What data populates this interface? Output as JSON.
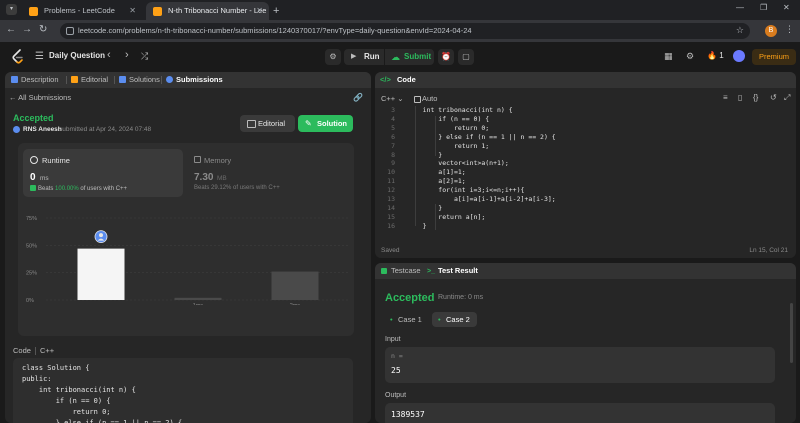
{
  "browser": {
    "tabs": [
      {
        "title": "Problems - LeetCode"
      },
      {
        "title": "N-th Tribonacci Number - Lee"
      }
    ],
    "url": "leetcode.com/problems/n-th-tribonacci-number/submissions/1240370017/?envType=daily-question&envId=2024-04-24",
    "profile_initial": "B"
  },
  "nav": {
    "list_label": "Daily Question",
    "run_label": "Run",
    "submit_label": "Submit",
    "streak": "1",
    "premium_label": "Premium"
  },
  "left": {
    "tabs": [
      "Description",
      "Editorial",
      "Solutions",
      "Submissions"
    ],
    "all_submissions": "All Submissions",
    "status": "Accepted",
    "username": "RNS Aneesh",
    "submitted_at": "submitted at Apr 24, 2024 07:48",
    "editorial_btn": "Editorial",
    "solution_btn": "Solution",
    "runtime": {
      "label": "Runtime",
      "value": "0",
      "unit": "ms",
      "beats_prefix": "Beats",
      "beats_pct": "100.00%",
      "beats_suffix": "of users with C++"
    },
    "memory": {
      "label": "Memory",
      "value": "7.30",
      "unit": "MB",
      "beats_text": "Beats 29.12% of users with C++"
    },
    "code_label": "Code",
    "lang_label": "C++",
    "code_lines": [
      "class Solution {",
      "public:",
      "    int tribonacci(int n) {",
      "        if (n == 0) {",
      "            return 0;",
      "        } else if (n == 1 || n == 2) {"
    ]
  },
  "chart_data": {
    "type": "bar",
    "categories": [
      "0ms",
      "1ms",
      "2ms"
    ],
    "values": [
      47,
      2,
      26
    ],
    "ylim": [
      0,
      75
    ],
    "yticks": [
      "75%",
      "50%",
      "25%",
      "0%"
    ],
    "xlabels": [
      "",
      "1ms",
      "2ms"
    ],
    "highlight_index": 0,
    "highlight_color": "#f5f5f5",
    "bar_color": "#4a4a4a",
    "grid": true
  },
  "code": {
    "title": "Code",
    "language": "C++",
    "mode": "Auto",
    "lines": [
      {
        "n": "3",
        "t": "    int tribonacci(int n) {"
      },
      {
        "n": "4",
        "t": "        if (n == 0) {"
      },
      {
        "n": "5",
        "t": "            return 0;"
      },
      {
        "n": "6",
        "t": "        } else if (n == 1 || n == 2) {"
      },
      {
        "n": "7",
        "t": "            return 1;"
      },
      {
        "n": "8",
        "t": "        }"
      },
      {
        "n": "9",
        "t": "        vector<int>a(n+1);"
      },
      {
        "n": "10",
        "t": "        a[1]=1;"
      },
      {
        "n": "11",
        "t": "        a[2]=1;"
      },
      {
        "n": "12",
        "t": "        for(int i=3;i<=n;i++){"
      },
      {
        "n": "13",
        "t": "            a[i]=a[i-1]+a[i-2]+a[i-3];"
      },
      {
        "n": "14",
        "t": "        }"
      },
      {
        "n": "15",
        "t": "        return a[n];"
      },
      {
        "n": "16",
        "t": "    }"
      }
    ],
    "saved": "Saved",
    "cursor": "Ln 15, Col 21"
  },
  "result": {
    "testcase_tab": "Testcase",
    "testresult_tab": "Test Result",
    "status": "Accepted",
    "runtime": "Runtime: 0 ms",
    "cases": [
      "Case 1",
      "Case 2"
    ],
    "input_label": "Input",
    "input_var": "n =",
    "input_value": "25",
    "output_label": "Output",
    "output_value": "1389537"
  },
  "colors": {
    "accent_green": "#2cbb5d",
    "accent_orange": "#ffa116"
  }
}
